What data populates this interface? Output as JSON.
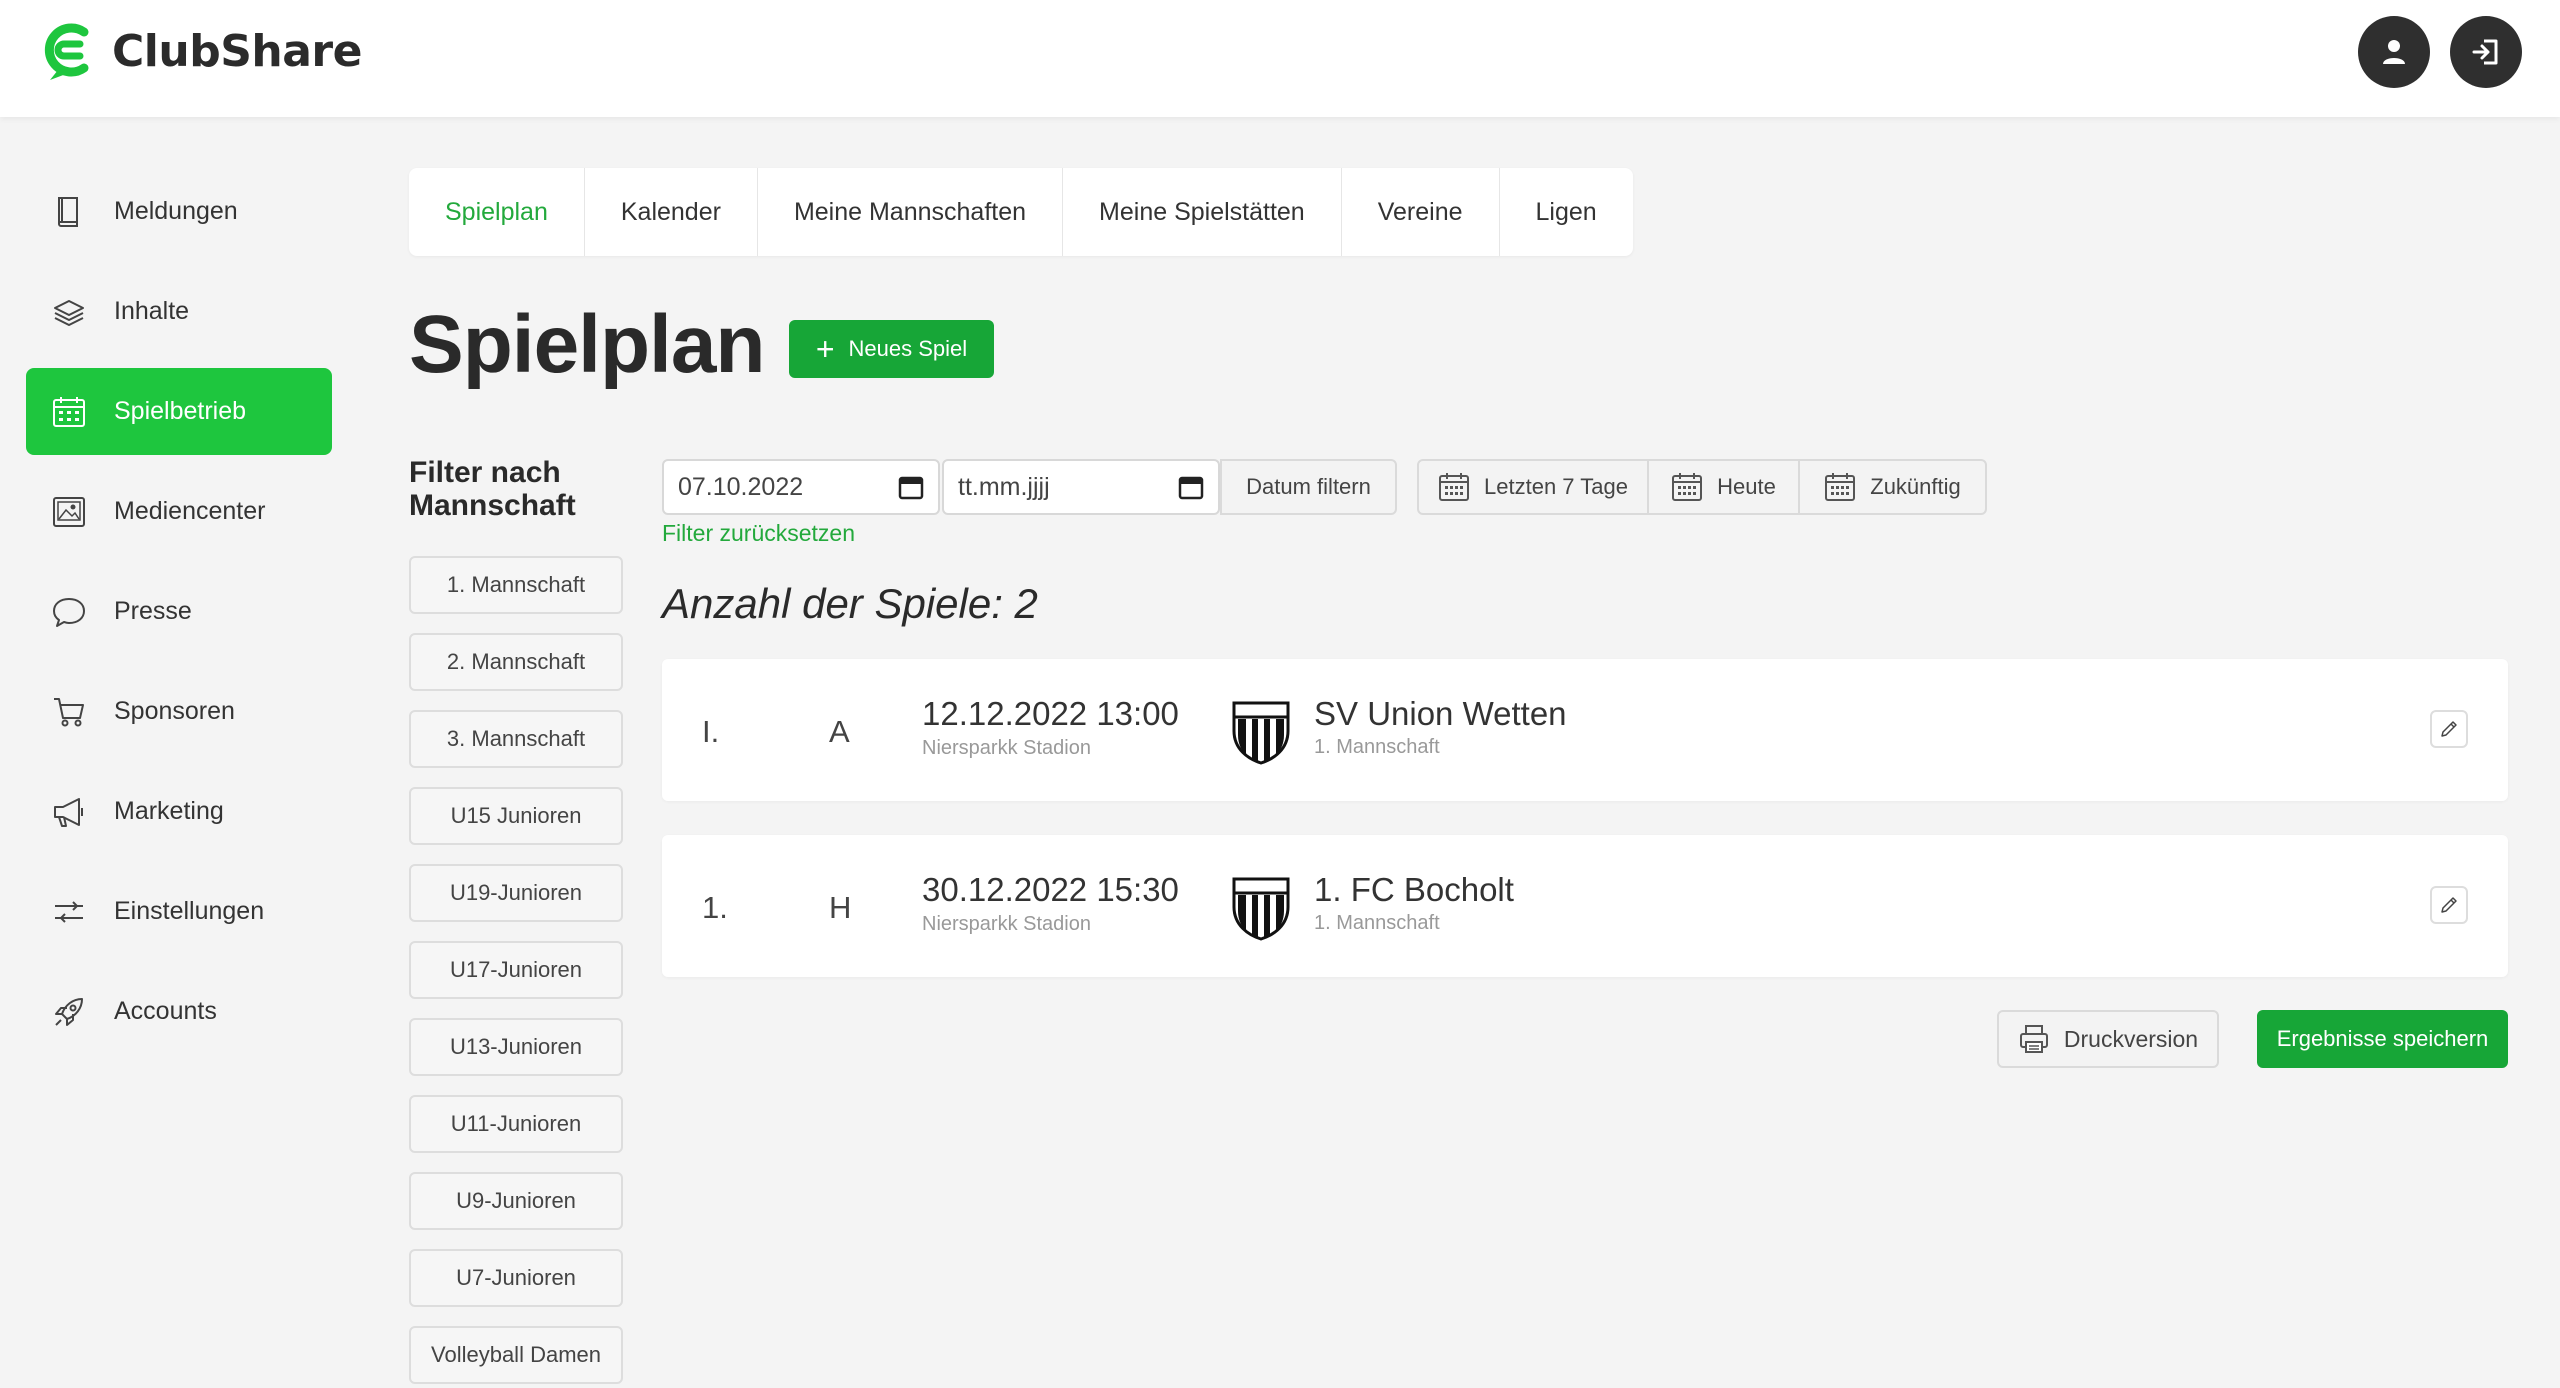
{
  "app": {
    "name": "ClubShare"
  },
  "header": {
    "profile_icon": "user-icon",
    "logout_icon": "sign-out-icon"
  },
  "colors": {
    "accent": "#1ec63e",
    "button_green": "#17a637",
    "link_green": "#23a93c",
    "dark": "#2f2f2f"
  },
  "sidebar": {
    "items": [
      {
        "label": "Meldungen",
        "icon": "book-icon",
        "active": false
      },
      {
        "label": "Inhalte",
        "icon": "layers-icon",
        "active": false
      },
      {
        "label": "Spielbetrieb",
        "icon": "calendar-icon",
        "active": true
      },
      {
        "label": "Mediencenter",
        "icon": "image-icon",
        "active": false
      },
      {
        "label": "Presse",
        "icon": "chat-bubble-icon",
        "active": false
      },
      {
        "label": "Sponsoren",
        "icon": "cart-icon",
        "active": false
      },
      {
        "label": "Marketing",
        "icon": "megaphone-icon",
        "active": false
      },
      {
        "label": "Einstellungen",
        "icon": "sliders-icon",
        "active": false
      },
      {
        "label": "Accounts",
        "icon": "rocket-icon",
        "active": false
      }
    ]
  },
  "tabs": [
    {
      "label": "Spielplan",
      "active": true
    },
    {
      "label": "Kalender",
      "active": false
    },
    {
      "label": "Meine Mannschaften",
      "active": false
    },
    {
      "label": "Meine Spielstätten",
      "active": false
    },
    {
      "label": "Vereine",
      "active": false
    },
    {
      "label": "Ligen",
      "active": false
    }
  ],
  "page": {
    "title": "Spielplan",
    "new_game_label": "Neues Spiel"
  },
  "filter": {
    "title": "Filter nach Mannschaft",
    "teams": [
      "1. Mannschaft",
      "2. Mannschaft",
      "3. Mannschaft",
      "U15 Junioren",
      "U19-Junioren",
      "U17-Junioren",
      "U13-Junioren",
      "U11-Junioren",
      "U9-Junioren",
      "U7-Junioren",
      "Volleyball Damen"
    ],
    "date_from_value": "07.10.2022",
    "date_to_placeholder": "tt.mm.jjjj",
    "date_filter_label": "Datum filtern",
    "last7_label": "Letzten 7 Tage",
    "today_label": "Heute",
    "future_label": "Zukünftig",
    "reset_label": "Filter zurücksetzen"
  },
  "count_label": "Anzahl der Spiele: 2",
  "matches": [
    {
      "num": "I.",
      "home_away": "A",
      "datetime": "12.12.2022 13:00",
      "venue": "Niersparkk Stadion",
      "team": "SV Union Wetten",
      "squad": "1. Mannschaft"
    },
    {
      "num": "1.",
      "home_away": "H",
      "datetime": "30.12.2022 15:30",
      "venue": "Niersparkk Stadion",
      "team": "1. FC Bocholt",
      "squad": "1. Mannschaft"
    }
  ],
  "actions": {
    "print_label": "Druckversion",
    "save_label": "Ergebnisse speichern"
  }
}
